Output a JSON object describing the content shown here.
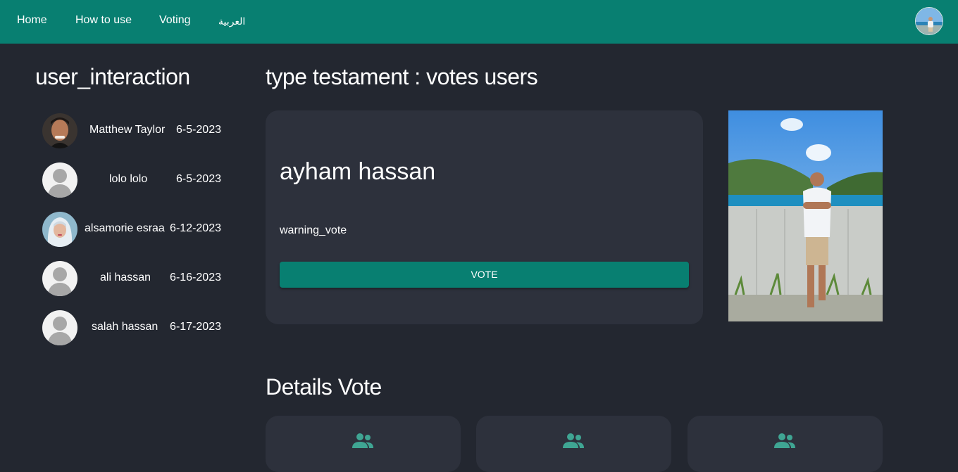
{
  "nav": {
    "links": [
      {
        "label": "Home"
      },
      {
        "label": "How to use"
      },
      {
        "label": "Voting"
      },
      {
        "label": "العربية"
      }
    ],
    "avatar_icon": "profile-avatar"
  },
  "sidebar": {
    "title": "user_interaction",
    "users": [
      {
        "name": "Matthew Taylor",
        "date": "6-5-2023",
        "avatar": "photo-man"
      },
      {
        "name": "lolo lolo",
        "date": "6-5-2023",
        "avatar": "default-avatar"
      },
      {
        "name": "alsamorie esraa",
        "date": "6-12-2023",
        "avatar": "photo-woman-hijab"
      },
      {
        "name": "ali hassan",
        "date": "6-16-2023",
        "avatar": "default-avatar"
      },
      {
        "name": "salah hassan",
        "date": "6-17-2023",
        "avatar": "default-avatar"
      }
    ]
  },
  "main": {
    "title": "type testament : votes users",
    "card": {
      "name": "ayham hassan",
      "warning": "warning_vote",
      "button_label": "VOTE"
    },
    "details": {
      "title": "Details Vote",
      "cards": [
        {
          "icon": "group-icon"
        },
        {
          "icon": "group-icon"
        },
        {
          "icon": "group-icon"
        }
      ]
    }
  },
  "colors": {
    "accent": "#087f71",
    "background": "#232730",
    "card": "#2d313c",
    "icon": "#3fa593"
  }
}
